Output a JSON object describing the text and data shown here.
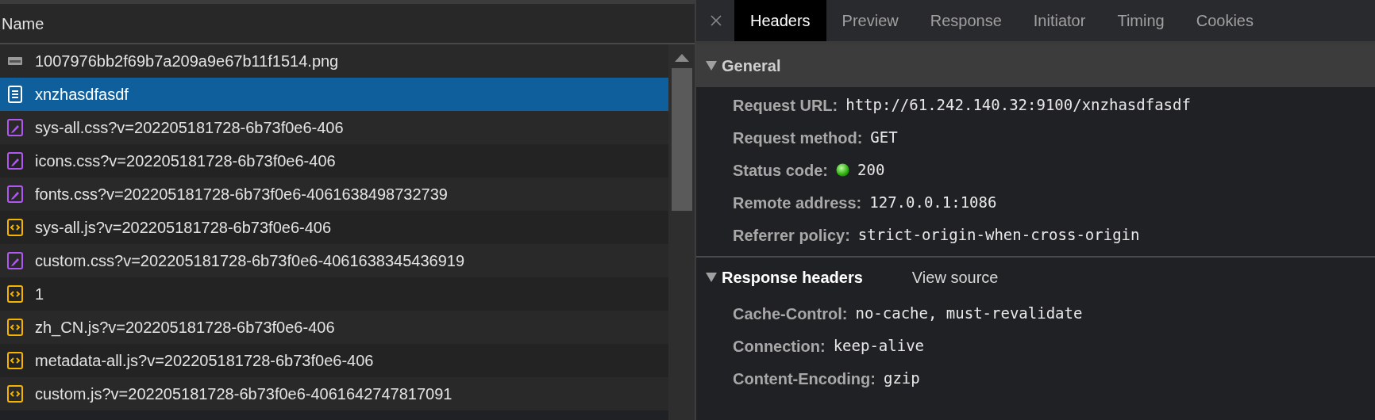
{
  "name_column": {
    "header": "Name"
  },
  "requests": [
    {
      "name": "1007976bb2f69b7a209a9e67b11f1514.png",
      "kind": "image",
      "selected": false
    },
    {
      "name": "xnzhasdfasdf",
      "kind": "document",
      "selected": true
    },
    {
      "name": "sys-all.css?v=202205181728-6b73f0e6-406",
      "kind": "stylesheet",
      "selected": false
    },
    {
      "name": "icons.css?v=202205181728-6b73f0e6-406",
      "kind": "stylesheet",
      "selected": false
    },
    {
      "name": "fonts.css?v=202205181728-6b73f0e6-4061638498732739",
      "kind": "stylesheet",
      "selected": false
    },
    {
      "name": "sys-all.js?v=202205181728-6b73f0e6-406",
      "kind": "script",
      "selected": false
    },
    {
      "name": "custom.css?v=202205181728-6b73f0e6-4061638345436919",
      "kind": "stylesheet",
      "selected": false
    },
    {
      "name": "1",
      "kind": "script",
      "selected": false
    },
    {
      "name": "zh_CN.js?v=202205181728-6b73f0e6-406",
      "kind": "script",
      "selected": false
    },
    {
      "name": "metadata-all.js?v=202205181728-6b73f0e6-406",
      "kind": "script",
      "selected": false
    },
    {
      "name": "custom.js?v=202205181728-6b73f0e6-4061642747817091",
      "kind": "script",
      "selected": false
    }
  ],
  "detail_tabs": [
    {
      "label": "Headers",
      "selected": true
    },
    {
      "label": "Preview",
      "selected": false
    },
    {
      "label": "Response",
      "selected": false
    },
    {
      "label": "Initiator",
      "selected": false
    },
    {
      "label": "Timing",
      "selected": false
    },
    {
      "label": "Cookies",
      "selected": false
    }
  ],
  "general": {
    "title": "General",
    "expanded": true,
    "rows": [
      {
        "label": "Request URL:",
        "value": "http://61.242.140.32:9100/xnzhasdfasdf",
        "kind": "text"
      },
      {
        "label": "Request method:",
        "value": "GET",
        "kind": "text"
      },
      {
        "label": "Status code:",
        "value": "200",
        "kind": "status"
      },
      {
        "label": "Remote address:",
        "value": "127.0.0.1:1086",
        "kind": "text"
      },
      {
        "label": "Referrer policy:",
        "value": "strict-origin-when-cross-origin",
        "kind": "text"
      }
    ]
  },
  "response_headers": {
    "title": "Response headers",
    "expanded": true,
    "link": "View source",
    "rows": [
      {
        "label": "Cache-Control:",
        "value": "no-cache, must-revalidate",
        "kind": "text"
      },
      {
        "label": "Connection:",
        "value": "keep-alive",
        "kind": "text"
      },
      {
        "label": "Content-Encoding:",
        "value": "gzip",
        "kind": "text"
      }
    ]
  }
}
